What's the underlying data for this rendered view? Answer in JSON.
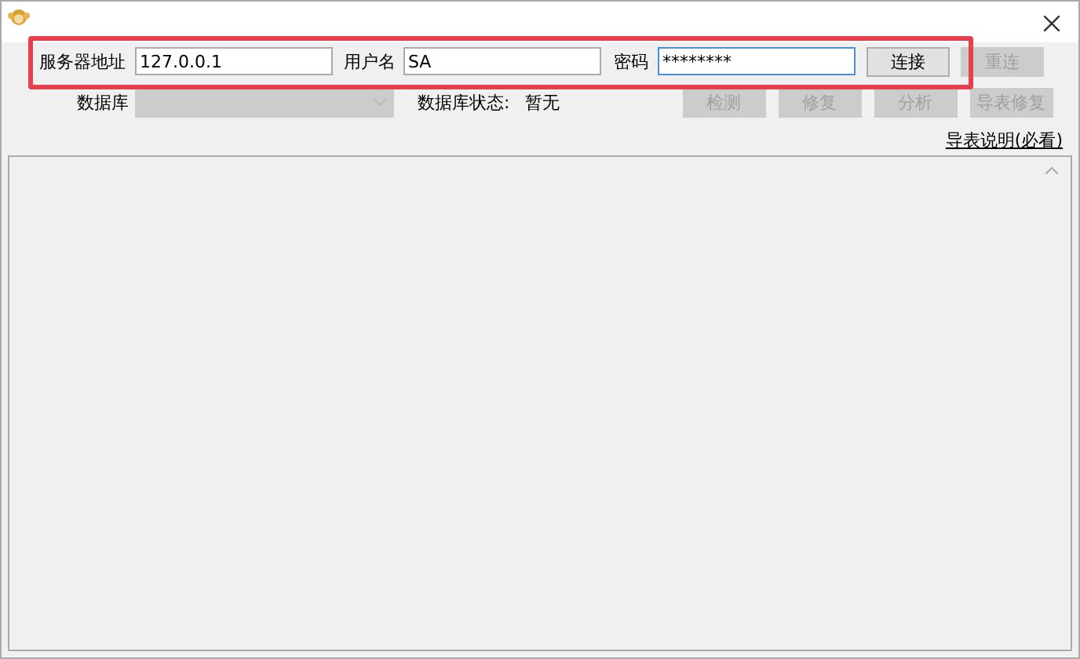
{
  "connection": {
    "server": {
      "label": "服务器地址",
      "value": "127.0.0.1"
    },
    "user": {
      "label": "用户名",
      "value": "SA"
    },
    "password": {
      "label": "密码",
      "value": "********",
      "focused": true
    },
    "buttons": [
      {
        "label": "连接",
        "disabled": false
      },
      {
        "label": "重连",
        "disabled": true
      }
    ]
  },
  "database": {
    "label": "数据库",
    "disabled": true,
    "status_label": "数据库状态:",
    "status": "暂无",
    "buttons": [
      {
        "label": "检测",
        "disabled": true
      },
      {
        "label": "修复",
        "disabled": true
      },
      {
        "label": "分析",
        "disabled": true
      },
      {
        "label": "导表修复",
        "disabled": true
      }
    ]
  },
  "help_link": "导表说明(必看)"
}
